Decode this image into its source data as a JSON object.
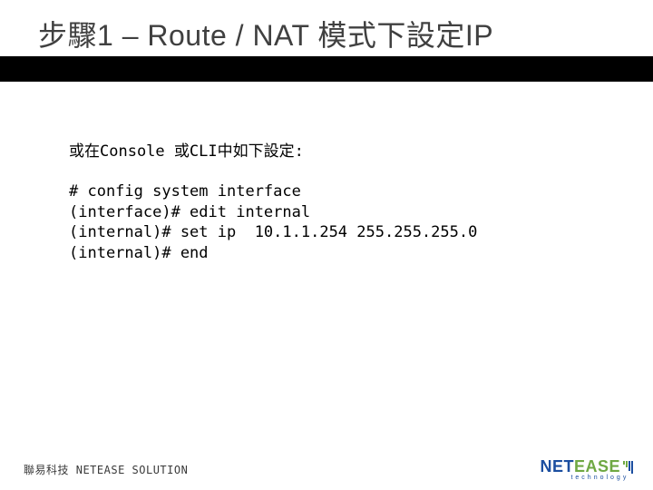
{
  "title": "步驟1 – Route / NAT 模式下設定IP",
  "intro": "或在Console 或CLI中如下設定:",
  "cli": {
    "line1": "# config system interface",
    "line2": "(interface)# edit internal",
    "line3": "(internal)# set ip  10.1.1.254 255.255.255.0",
    "line4": "(internal)# end"
  },
  "footer": "聯易科技  NETEASE SOLUTION",
  "logo": {
    "part1": "NET",
    "part2": "EASE",
    "sub": "technology"
  }
}
